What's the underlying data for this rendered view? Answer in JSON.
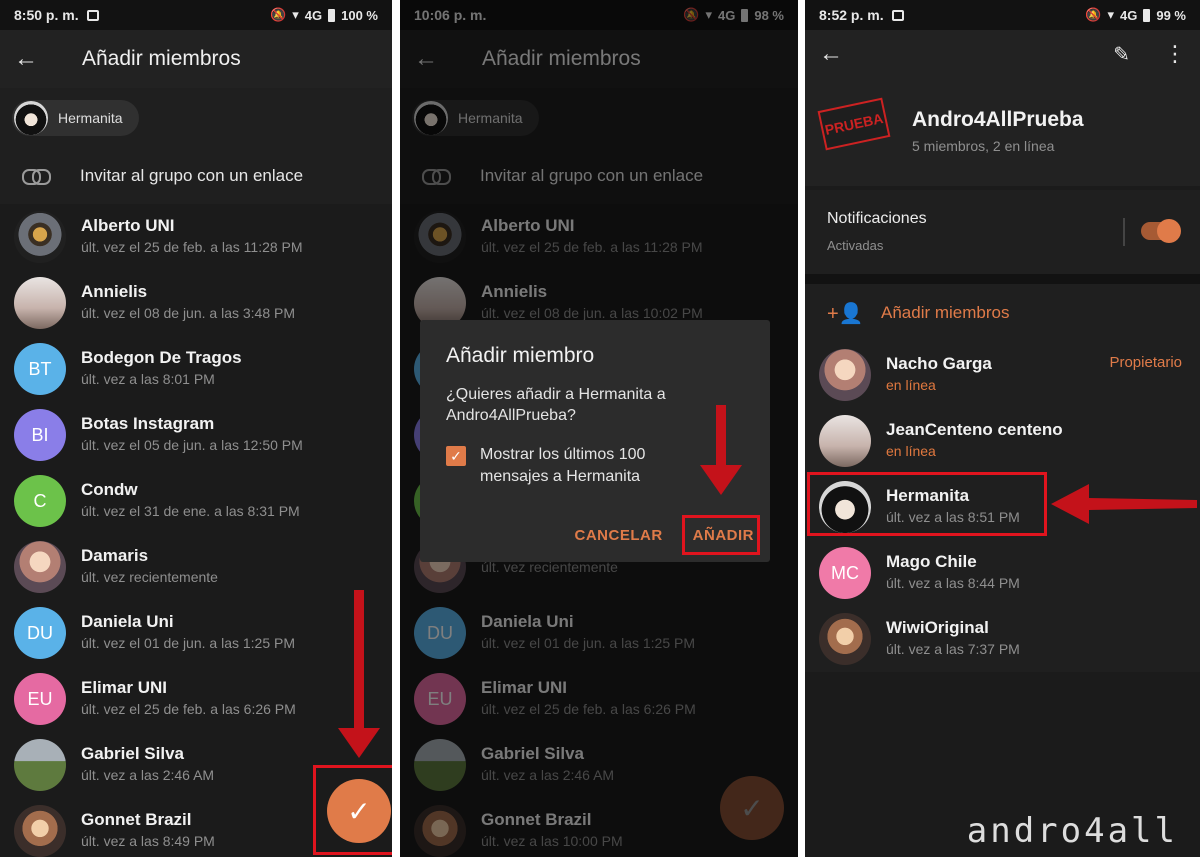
{
  "screen1": {
    "status": {
      "time": "8:50 p. m.",
      "network": "4G",
      "battery": "100 %"
    },
    "title": "Añadir miembros",
    "chip": "Hermanita",
    "invite": "Invitar al grupo con un enlace",
    "contacts": [
      {
        "name": "Alberto UNI",
        "status": "últ. vez el 25 de feb. a las 11:28 PM"
      },
      {
        "name": "Annielis",
        "status": "últ. vez el 08 de jun. a las 3:48 PM"
      },
      {
        "name": "Bodegon De Tragos",
        "status": "últ. vez a las 8:01 PM",
        "initials": "BT",
        "color": "#5ab2e8"
      },
      {
        "name": "Botas Instagram",
        "status": "últ. vez el 05 de jun. a las 12:50 PM",
        "initials": "BI",
        "color": "#8a7ee8"
      },
      {
        "name": "Condw",
        "status": "últ. vez el 31 de ene. a las 8:31 PM",
        "initials": "C",
        "color": "#6cc24a"
      },
      {
        "name": "Damaris",
        "status": "últ. vez recientemente"
      },
      {
        "name": "Daniela Uni",
        "status": "últ. vez el 01 de jun. a las 1:25 PM",
        "initials": "DU",
        "color": "#5ab2e8"
      },
      {
        "name": "Elimar UNI",
        "status": "últ. vez el 25 de feb. a las 6:26 PM",
        "initials": "EU",
        "color": "#e56aa2"
      },
      {
        "name": "Gabriel Silva",
        "status": "últ. vez a las 2:46 AM"
      },
      {
        "name": "Gonnet Brazil",
        "status": "últ. vez a las 8:49 PM"
      }
    ],
    "fab_icon": "check-icon"
  },
  "screen2": {
    "status": {
      "time": "10:06 p. m.",
      "network": "4G",
      "battery": "98 %"
    },
    "title": "Añadir miembros",
    "chip": "Hermanita",
    "invite": "Invitar al grupo con un enlace",
    "contacts": [
      {
        "name": "Alberto UNI",
        "status": "últ. vez el 25 de feb. a las 11:28 PM"
      },
      {
        "name": "Annielis",
        "status": "últ. vez el 08 de jun. a las 10:02 PM"
      },
      {
        "name": "",
        "status": ""
      },
      {
        "name": "",
        "status": ""
      },
      {
        "name": "",
        "status": ""
      },
      {
        "name": "",
        "status": "últ. vez recientemente"
      },
      {
        "name": "Daniela Uni",
        "status": "últ. vez el 01 de jun. a las 1:25 PM",
        "initials": "DU",
        "color": "#5ab2e8"
      },
      {
        "name": "Elimar UNI",
        "status": "últ. vez el 25 de feb. a las 6:26 PM",
        "initials": "EU",
        "color": "#e56aa2"
      },
      {
        "name": "Gabriel Silva",
        "status": "últ. vez a las 2:46 AM"
      },
      {
        "name": "Gonnet Brazil",
        "status": "últ. vez a las 10:00 PM"
      }
    ],
    "dialog": {
      "title": "Añadir miembro",
      "question": "¿Quieres añadir a Hermanita a Andro4AllPrueba?",
      "checkbox": "Mostrar los últimos 100 mensajes a Hermanita",
      "cancel": "CANCELAR",
      "add": "AÑADIR"
    }
  },
  "screen3": {
    "status": {
      "time": "8:52 p. m.",
      "network": "4G",
      "battery": "99 %"
    },
    "group": {
      "name": "Andro4AllPrueba",
      "subtitle": "5 miembros, 2 en línea",
      "logo_text": "PRUEBA"
    },
    "notifications": {
      "title": "Notificaciones",
      "state": "Activadas"
    },
    "add_members": "Añadir miembros",
    "members": [
      {
        "name": "Nacho Garga",
        "status": "en línea",
        "online": true,
        "role": "Propietario"
      },
      {
        "name": "JeanCenteno centeno",
        "status": "en línea",
        "online": true
      },
      {
        "name": "Hermanita",
        "status": "últ. vez a las 8:51 PM"
      },
      {
        "name": "Mago Chile",
        "status": "últ. vez a las 8:44 PM",
        "initials": "MC",
        "color": "#f07aa8"
      },
      {
        "name": "WiwiOriginal",
        "status": "últ. vez a las 7:37 PM"
      }
    ]
  },
  "watermark": "andro4all",
  "colors": {
    "accent": "#e07b49",
    "highlight": "#e0141e",
    "background": "#1b1b1b"
  }
}
